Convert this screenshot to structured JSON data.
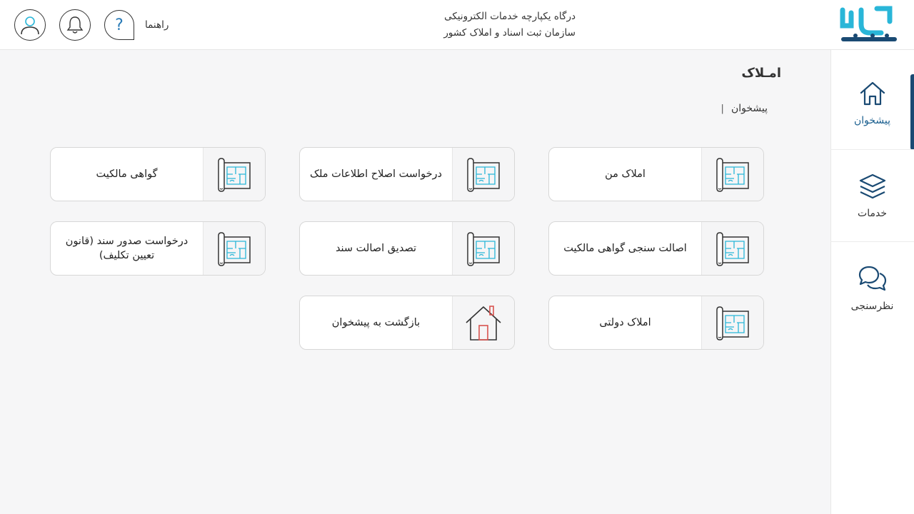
{
  "header": {
    "logo_text": "ثبت من",
    "portal_title_line1": "درگاه یکپارچه خدمات الکترونیکی",
    "portal_title_line2": "سازمان ثبت اسناد و املاک کشور",
    "help_label": "راهنما",
    "help_symbol": "?",
    "icons": [
      "user-icon",
      "bell-icon",
      "help-icon"
    ]
  },
  "sidebar": {
    "items": [
      {
        "label": "پیشخوان",
        "icon": "home-icon",
        "active": true
      },
      {
        "label": "خدمات",
        "icon": "layers-icon",
        "active": false
      },
      {
        "label": "نظرسنجی",
        "icon": "chat-bubbles-icon",
        "active": false
      }
    ]
  },
  "main": {
    "title": "امـلاک",
    "breadcrumb": {
      "current": "پیشخوان",
      "separator": "|"
    },
    "cards": [
      {
        "label": "املاک من",
        "icon": "blueprint-icon"
      },
      {
        "label": "درخواست اصلاح اطلاعات ملک",
        "icon": "blueprint-icon"
      },
      {
        "label": "گواهی مالکیت",
        "icon": "blueprint-icon"
      },
      {
        "label": "اصالت سنجی گواهی مالکیت",
        "icon": "blueprint-icon"
      },
      {
        "label": "تصدیق اصالت سند",
        "icon": "blueprint-icon"
      },
      {
        "label": "درخواست صدور سند (قانون تعیین تکلیف)",
        "icon": "blueprint-icon"
      },
      {
        "label": "املاک دولتی",
        "icon": "blueprint-icon"
      },
      {
        "label": "بازگشت به پیشخوان",
        "icon": "house-icon"
      }
    ]
  },
  "colors": {
    "brand_blue": "#1a4a73",
    "accent_cyan": "#29b6d8",
    "background": "#f6f6f7"
  }
}
